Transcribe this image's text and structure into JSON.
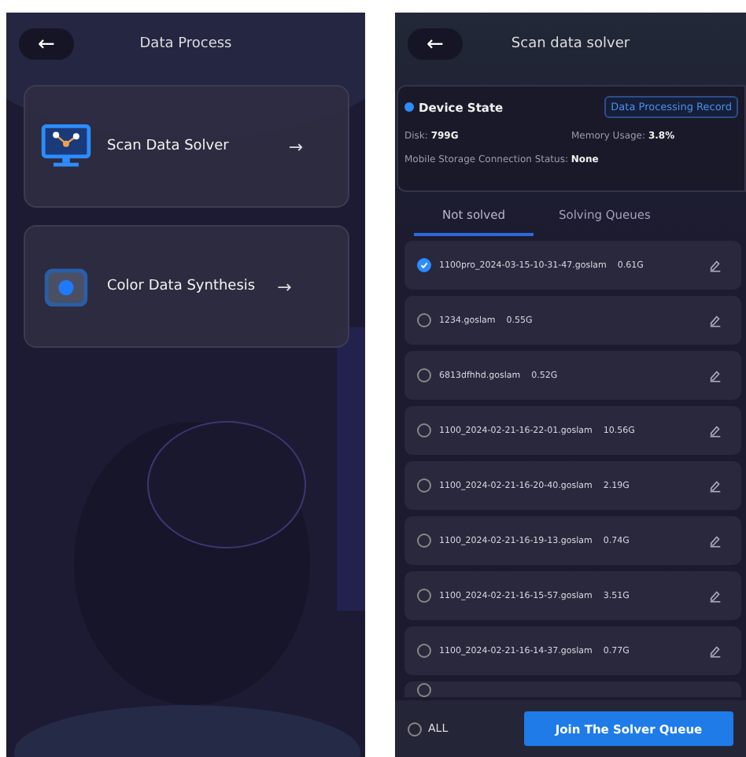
{
  "left_screen": {
    "title": "Data Process",
    "back": "←",
    "cards": [
      {
        "kind": "scan",
        "label": "Scan Data Solver",
        "arrow": "→"
      },
      {
        "kind": "color",
        "label": "Color Data Synthesis",
        "arrow": "→"
      }
    ]
  },
  "right_screen": {
    "title": "Scan data solver",
    "back": "←",
    "device": {
      "title": "Device State",
      "record_button": "Data Processing Record",
      "disk_label": "Disk:",
      "disk_value": "799G",
      "memory_label": "Memory Usage:",
      "memory_value": "3.8%",
      "storage_label": "Mobile Storage Connection Status:",
      "storage_value": "None"
    },
    "tabs": [
      {
        "label": "Not solved",
        "selected": true
      },
      {
        "label": "Solving Queues",
        "selected": false
      }
    ],
    "files": [
      {
        "name": "1100pro_2024-03-15-10-31-47.goslam",
        "size": "0.61G",
        "selected": true
      },
      {
        "name": "1234.goslam",
        "size": "0.55G",
        "selected": false
      },
      {
        "name": "6813dfhhd.goslam",
        "size": "0.52G",
        "selected": false
      },
      {
        "name": "1100_2024-02-21-16-22-01.goslam",
        "size": "10.56G",
        "selected": false
      },
      {
        "name": "1100_2024-02-21-16-20-40.goslam",
        "size": "2.19G",
        "selected": false
      },
      {
        "name": "1100_2024-02-21-16-19-13.goslam",
        "size": "0.74G",
        "selected": false
      },
      {
        "name": "1100_2024-02-21-16-15-57.goslam",
        "size": "3.51G",
        "selected": false
      },
      {
        "name": "1100_2024-02-21-16-14-37.goslam",
        "size": "0.77G",
        "selected": false
      }
    ],
    "partial_row": {
      "selected": false
    },
    "select_all": {
      "label": "ALL",
      "selected": false
    },
    "join_button": "Join The Solver Queue"
  }
}
